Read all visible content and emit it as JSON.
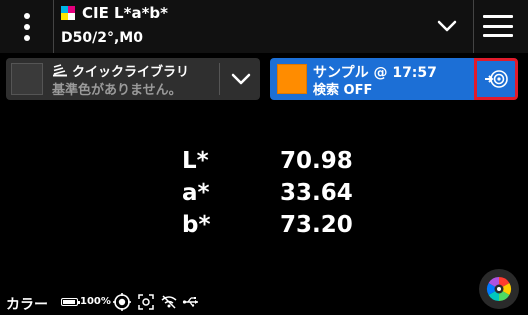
{
  "header": {
    "title": "CIE L*a*b*",
    "subtitle": "D50/2°,M0",
    "menu_icon": "kebab-menu-icon",
    "dropdown_icon": "chevron-down-icon",
    "hamburger_icon": "hamburger-menu-icon"
  },
  "quick_library": {
    "title": "クイックライブラリ",
    "subtitle": "基準色がありません。",
    "icon": "library-stack-icon"
  },
  "sample": {
    "line1": "サンプル @ 17:57",
    "line2": "検索 OFF",
    "swatch_color": "#ff8c00",
    "action_icon": "target-measure-icon"
  },
  "values": [
    {
      "label": "L*",
      "value": "70.98"
    },
    {
      "label": "a*",
      "value": "33.64"
    },
    {
      "label": "b*",
      "value": "73.20"
    }
  ],
  "status": {
    "label": "カラー",
    "battery": "100%",
    "icons": [
      "battery-icon",
      "target-icon",
      "camera-focus-icon",
      "wifi-off-icon",
      "usb-icon"
    ]
  },
  "fab_icon": "color-wheel-icon",
  "colors": {
    "accent": "#1c6fd6",
    "highlight": "#e11b2b",
    "background": "#000000"
  }
}
